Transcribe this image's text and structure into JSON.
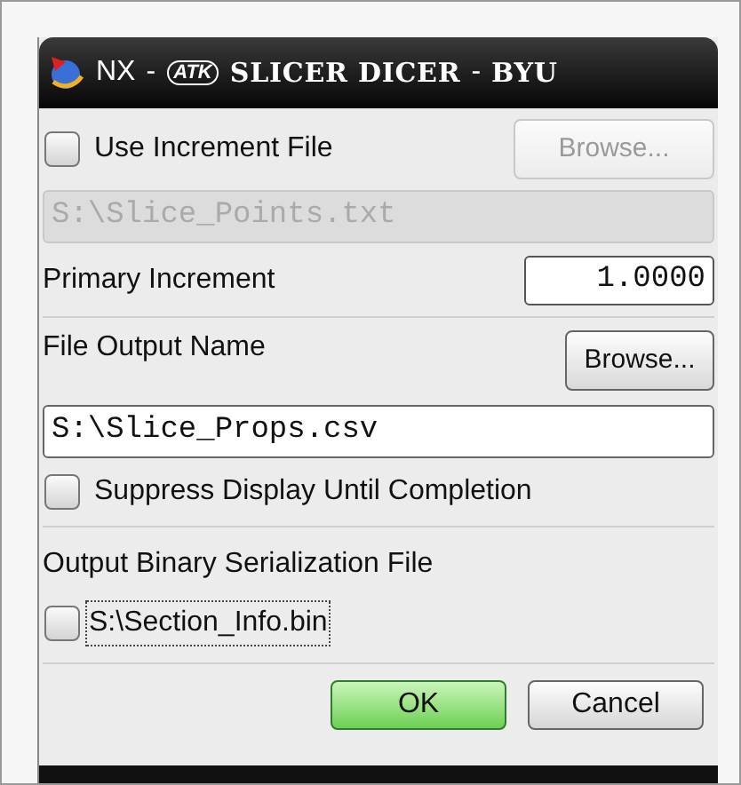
{
  "window": {
    "title_parts": [
      {
        "kind": "plain",
        "text": "NX"
      },
      {
        "kind": "plain",
        "text": "-"
      },
      {
        "kind": "badge",
        "text": "ATK"
      },
      {
        "kind": "bold",
        "text": "SLICER DICER"
      },
      {
        "kind": "plain",
        "text": "-"
      },
      {
        "kind": "bold",
        "text": "BYU"
      }
    ]
  },
  "use_increment_file": {
    "label": "Use Increment File",
    "checked": false,
    "browse": {
      "label": "Browse...",
      "disabled": true
    }
  },
  "increment_file_field": {
    "value": "S:\\Slice_Points.txt",
    "disabled": true
  },
  "primary_increment": {
    "label": "Primary Increment",
    "value": "1.0000"
  },
  "file_output": {
    "label": "File Output Name",
    "browse": {
      "label": "Browse...",
      "disabled": false
    },
    "value": "S:\\Slice_Props.csv"
  },
  "suppress_display": {
    "label": "Suppress Display Until Completion",
    "checked": false
  },
  "binary_output": {
    "label": "Output Binary Serialization File",
    "checkbox_label": "S:\\Section_Info.bin",
    "checked": false
  },
  "buttons": [
    {
      "label": "OK",
      "kind": "primary"
    },
    {
      "label": "Cancel",
      "kind": "secondary"
    }
  ]
}
